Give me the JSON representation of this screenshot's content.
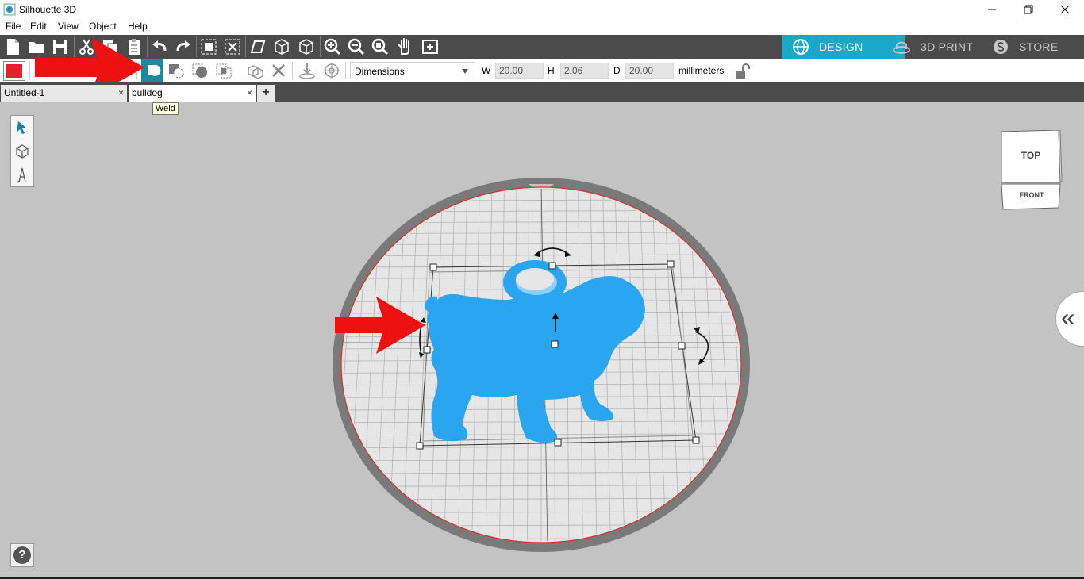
{
  "window": {
    "title": "Silhouette 3D"
  },
  "menu": [
    "File",
    "Edit",
    "View",
    "Object",
    "Help"
  ],
  "modes": [
    {
      "label": "DESIGN",
      "icon": "globe-icon",
      "active": true
    },
    {
      "label": "3D PRINT",
      "icon": "print-3d-icon",
      "active": false
    },
    {
      "label": "STORE",
      "icon": "store-icon",
      "active": false
    }
  ],
  "properties": {
    "mode_select": "Dimensions",
    "w_label": "W",
    "w_value": "20.00",
    "h_label": "H",
    "h_value": "2.06",
    "d_label": "D",
    "d_value": "20.00",
    "units": "millimeters"
  },
  "tabs": [
    {
      "label": "Untitled-1",
      "close": "×"
    },
    {
      "label": "bulldog",
      "close": "×"
    }
  ],
  "add_tab": "+",
  "tooltip": "Weld",
  "viewcube": {
    "top": "TOP",
    "front": "FRONT"
  },
  "collapse_icon": "«",
  "help": "?",
  "colors": {
    "accent": "#1ba7c7",
    "object": "#2aa6f0",
    "annotation_arrow": "#ee1111",
    "fill_swatch": "#e8202a"
  }
}
